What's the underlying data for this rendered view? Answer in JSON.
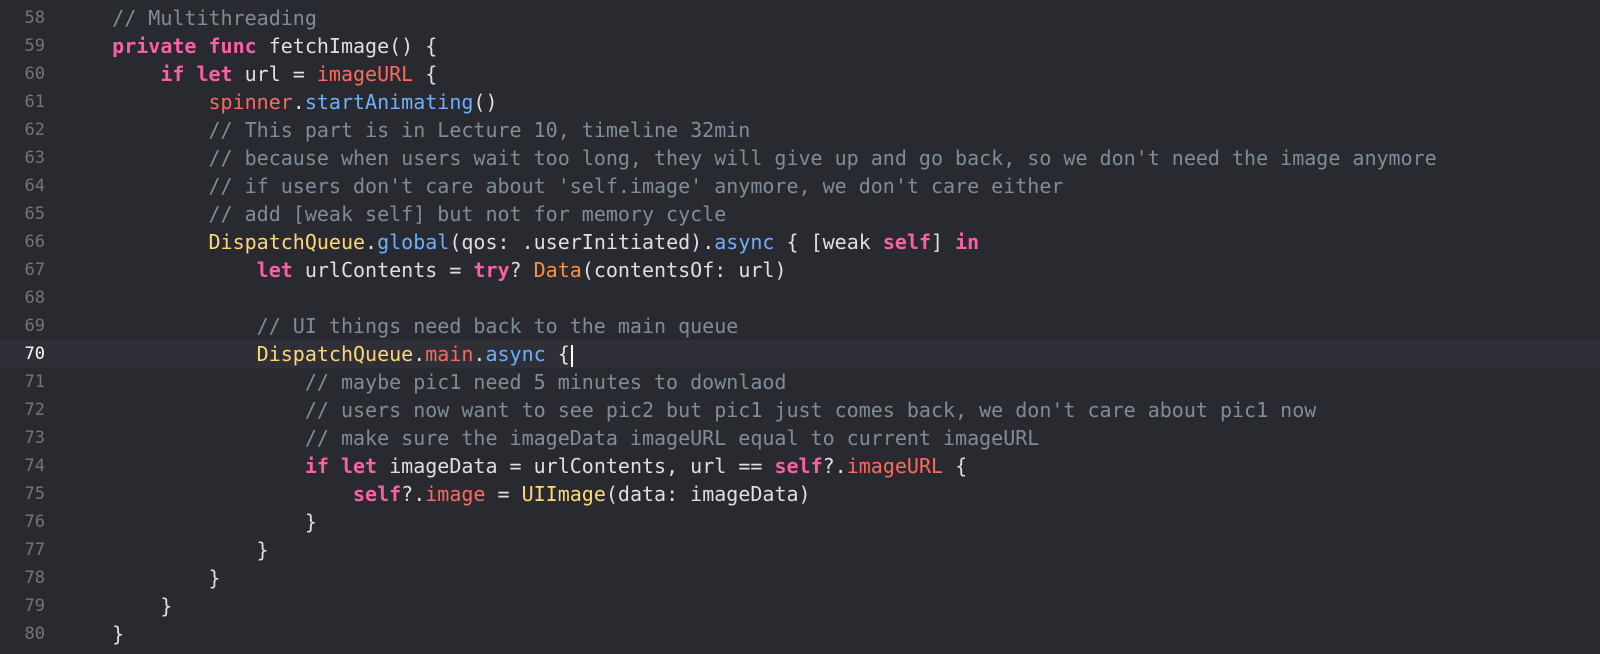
{
  "editor": {
    "theme_colors": {
      "background": "#292a30",
      "current_line": "#2f3037",
      "comment": "#7f8c98",
      "keyword": "#fc5fa3",
      "type": "#ffd675",
      "method": "#6bb0ff",
      "variable": "#fc6a5d"
    },
    "current_line_number": "70",
    "lines": [
      {
        "num": "58",
        "indent": "    ",
        "tokens": [
          {
            "t": "// Multithreading",
            "c": "comment"
          }
        ]
      },
      {
        "num": "59",
        "indent": "    ",
        "tokens": [
          {
            "t": "private",
            "c": "kw"
          },
          {
            "t": " ",
            "c": "plain"
          },
          {
            "t": "func",
            "c": "kw"
          },
          {
            "t": " fetchImage() {",
            "c": "plain"
          }
        ]
      },
      {
        "num": "60",
        "indent": "        ",
        "tokens": [
          {
            "t": "if",
            "c": "kw"
          },
          {
            "t": " ",
            "c": "plain"
          },
          {
            "t": "let",
            "c": "kw"
          },
          {
            "t": " url = ",
            "c": "plain"
          },
          {
            "t": "imageURL",
            "c": "var"
          },
          {
            "t": " {",
            "c": "plain"
          }
        ]
      },
      {
        "num": "61",
        "indent": "            ",
        "tokens": [
          {
            "t": "spinner",
            "c": "var"
          },
          {
            "t": ".",
            "c": "plain"
          },
          {
            "t": "startAnimating",
            "c": "call"
          },
          {
            "t": "()",
            "c": "plain"
          }
        ]
      },
      {
        "num": "62",
        "indent": "            ",
        "tokens": [
          {
            "t": "// This part is in Lecture 10, timeline 32min",
            "c": "comment"
          }
        ]
      },
      {
        "num": "63",
        "indent": "            ",
        "tokens": [
          {
            "t": "// because when users wait too long, they will give up and go back, so we don't need the image anymore",
            "c": "comment"
          }
        ]
      },
      {
        "num": "64",
        "indent": "            ",
        "tokens": [
          {
            "t": "// if users don't care about 'self.image' anymore, we don't care either",
            "c": "comment"
          }
        ]
      },
      {
        "num": "65",
        "indent": "            ",
        "tokens": [
          {
            "t": "// add [weak self] but not for memory cycle",
            "c": "comment"
          }
        ]
      },
      {
        "num": "66",
        "indent": "            ",
        "tokens": [
          {
            "t": "DispatchQueue",
            "c": "class"
          },
          {
            "t": ".",
            "c": "plain"
          },
          {
            "t": "global",
            "c": "call"
          },
          {
            "t": "(qos: .userInitiated).",
            "c": "plain"
          },
          {
            "t": "async",
            "c": "call"
          },
          {
            "t": " { [weak ",
            "c": "plain"
          },
          {
            "t": "self",
            "c": "kw"
          },
          {
            "t": "] ",
            "c": "plain"
          },
          {
            "t": "in",
            "c": "kw"
          }
        ]
      },
      {
        "num": "67",
        "indent": "                ",
        "tokens": [
          {
            "t": "let",
            "c": "kw"
          },
          {
            "t": " urlContents = ",
            "c": "plain"
          },
          {
            "t": "try",
            "c": "kw"
          },
          {
            "t": "? ",
            "c": "plain"
          },
          {
            "t": "Data",
            "c": "tryfn"
          },
          {
            "t": "(contentsOf: url)",
            "c": "plain"
          }
        ]
      },
      {
        "num": "68",
        "indent": "",
        "tokens": []
      },
      {
        "num": "69",
        "indent": "                ",
        "tokens": [
          {
            "t": "// UI things need back to the main queue",
            "c": "comment"
          }
        ]
      },
      {
        "num": "70",
        "indent": "                ",
        "tokens": [
          {
            "t": "DispatchQueue",
            "c": "class"
          },
          {
            "t": ".",
            "c": "plain"
          },
          {
            "t": "main",
            "c": "prop"
          },
          {
            "t": ".",
            "c": "plain"
          },
          {
            "t": "async",
            "c": "call"
          },
          {
            "t": " {",
            "c": "plain"
          }
        ],
        "cursor": true
      },
      {
        "num": "71",
        "indent": "                    ",
        "tokens": [
          {
            "t": "// maybe pic1 need 5 minutes to downlaod",
            "c": "comment"
          }
        ]
      },
      {
        "num": "72",
        "indent": "                    ",
        "tokens": [
          {
            "t": "// users now want to see pic2 but pic1 just comes back, we don't care about pic1 now",
            "c": "comment"
          }
        ]
      },
      {
        "num": "73",
        "indent": "                    ",
        "tokens": [
          {
            "t": "// make sure the imageData imageURL equal to current imageURL",
            "c": "comment"
          }
        ]
      },
      {
        "num": "74",
        "indent": "                    ",
        "tokens": [
          {
            "t": "if",
            "c": "kw"
          },
          {
            "t": " ",
            "c": "plain"
          },
          {
            "t": "let",
            "c": "kw"
          },
          {
            "t": " imageData = urlContents, url == ",
            "c": "plain"
          },
          {
            "t": "self",
            "c": "kw"
          },
          {
            "t": "?.",
            "c": "plain"
          },
          {
            "t": "imageURL",
            "c": "var"
          },
          {
            "t": " {",
            "c": "plain"
          }
        ]
      },
      {
        "num": "75",
        "indent": "                        ",
        "tokens": [
          {
            "t": "self",
            "c": "kw"
          },
          {
            "t": "?.",
            "c": "plain"
          },
          {
            "t": "image",
            "c": "var"
          },
          {
            "t": " = ",
            "c": "plain"
          },
          {
            "t": "UIImage",
            "c": "class"
          },
          {
            "t": "(data: imageData)",
            "c": "plain"
          }
        ]
      },
      {
        "num": "76",
        "indent": "                    ",
        "tokens": [
          {
            "t": "}",
            "c": "plain"
          }
        ]
      },
      {
        "num": "77",
        "indent": "                ",
        "tokens": [
          {
            "t": "}",
            "c": "plain"
          }
        ]
      },
      {
        "num": "78",
        "indent": "            ",
        "tokens": [
          {
            "t": "}",
            "c": "plain"
          }
        ]
      },
      {
        "num": "79",
        "indent": "        ",
        "tokens": [
          {
            "t": "}",
            "c": "plain"
          }
        ]
      },
      {
        "num": "80",
        "indent": "    ",
        "tokens": [
          {
            "t": "}",
            "c": "plain"
          }
        ]
      }
    ]
  }
}
